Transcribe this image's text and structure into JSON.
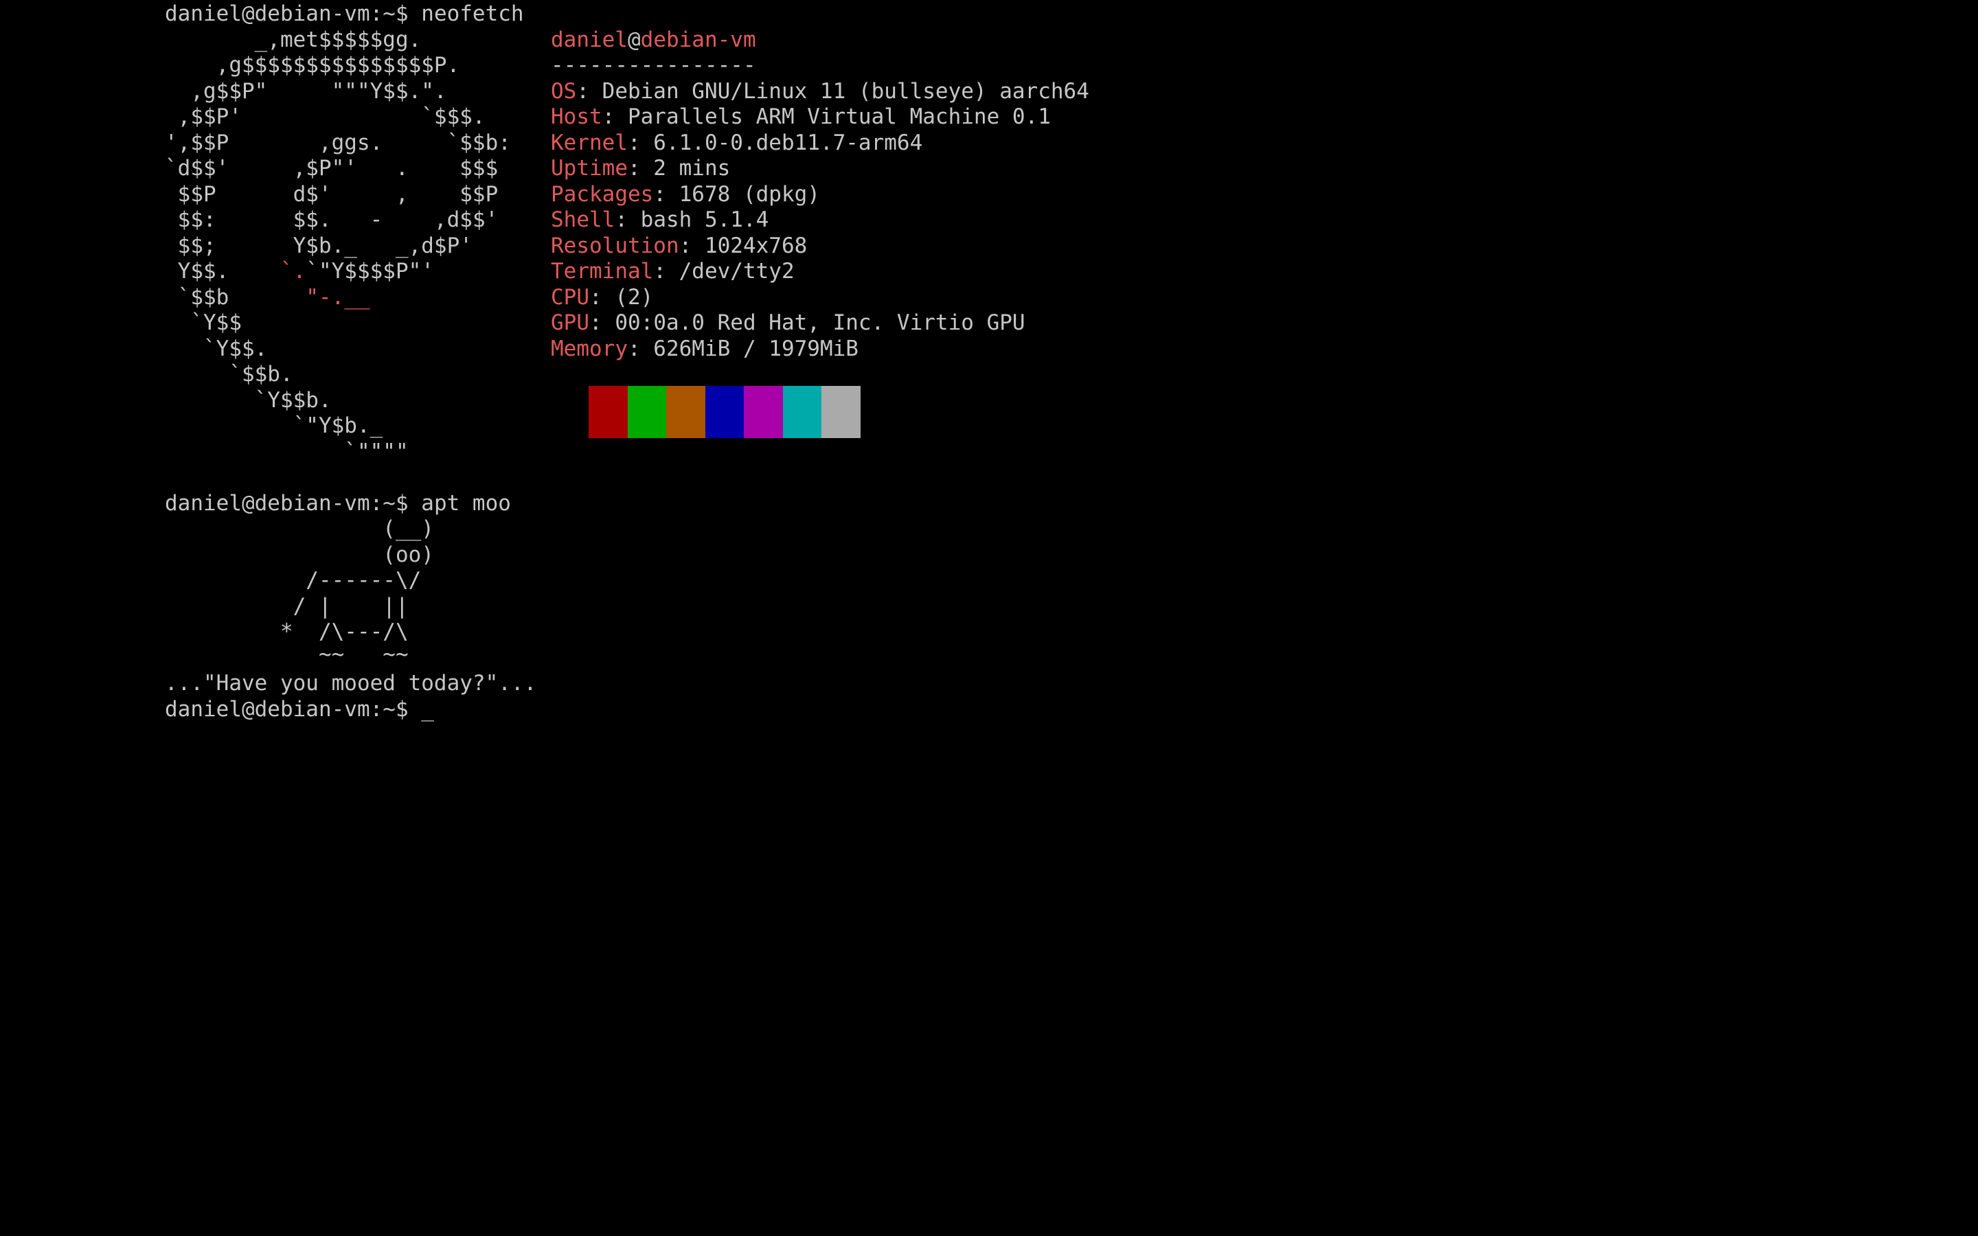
{
  "terminal": {
    "prompt": "daniel@debian-vm:~$ ",
    "commands": {
      "neofetch": "neofetch",
      "apt_moo": "apt moo"
    },
    "logo": [
      "       _,met$$$$$gg.",
      "    ,g$$$$$$$$$$$$$$$P.",
      "  ,g$$P\"     \"\"\"Y$$.\".",
      " ,$$P'              `$$$.",
      "',$$P       ,ggs.     `$$b:",
      "`d$$'     ,$P\"'   .    $$$",
      " $$P      d$'     ,    $$P",
      " $$:      $$.   -    ,d$$'",
      " $$;      Y$b._   _,d$P'",
      " Y$$.    `.`\"Y$$$$P\"'",
      " `$$b      \"-.__",
      "  `Y$$",
      "   `Y$$.",
      "     `$$b.",
      "       `Y$$b.",
      "          `\"Y$b._",
      "              `\"\"\"\""
    ],
    "logo_accents": {
      "dot1": ".",
      "comma": ",",
      "dash": "-",
      "backtick_dot": "`.",
      "quote_dash": "\"-.__"
    },
    "info": {
      "user": "daniel",
      "at": "@",
      "host": "debian-vm",
      "separator": "----------------",
      "rows": [
        {
          "key": "OS",
          "value": ": Debian GNU/Linux 11 (bullseye) aarch64"
        },
        {
          "key": "Host",
          "value": ": Parallels ARM Virtual Machine 0.1"
        },
        {
          "key": "Kernel",
          "value": ": 6.1.0-0.deb11.7-arm64"
        },
        {
          "key": "Uptime",
          "value": ": 2 mins"
        },
        {
          "key": "Packages",
          "value": ": 1678 (dpkg)"
        },
        {
          "key": "Shell",
          "value": ": bash 5.1.4"
        },
        {
          "key": "Resolution",
          "value": ": 1024x768"
        },
        {
          "key": "Terminal",
          "value": ": /dev/tty2"
        },
        {
          "key": "CPU",
          "value": ": (2)"
        },
        {
          "key": "GPU",
          "value": ": 00:0a.0 Red Hat, Inc. Virtio GPU"
        },
        {
          "key": "Memory",
          "value": ": 626MiB / 1979MiB"
        }
      ]
    },
    "color_swatches": [
      "#aa0000",
      "#00aa00",
      "#aa5500",
      "#0000aa",
      "#aa00aa",
      "#00aaaa",
      "#aaaaaa"
    ],
    "cow": [
      "                 (__)",
      "                 (oo)",
      "           /------\\/",
      "          / |    ||",
      "         *  /\\---/\\",
      "            ~~   ~~"
    ],
    "moo_message": "...\"Have you mooed today?\"...",
    "cursor": "_"
  },
  "colors": {
    "background": "#000000",
    "text": "#c7c7c7",
    "accent": "#e05a5a"
  }
}
